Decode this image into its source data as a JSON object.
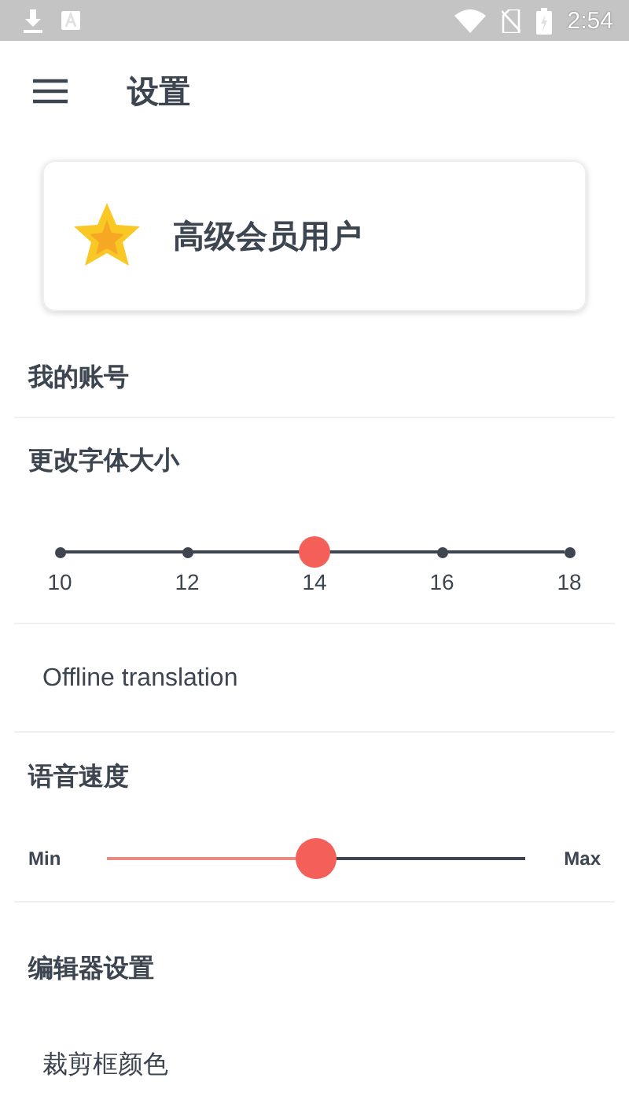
{
  "status_bar": {
    "time": "2:54"
  },
  "app_bar": {
    "title": "设置"
  },
  "premium_card": {
    "label": "高级会员用户"
  },
  "sections": [
    {
      "kind": "header",
      "label": "我的账号",
      "divider": true
    },
    {
      "kind": "steps",
      "label": "更改字体大小",
      "divider": true,
      "steps": [
        {
          "label": "10",
          "selected": false
        },
        {
          "label": "12",
          "selected": false
        },
        {
          "label": "14",
          "selected": true
        },
        {
          "label": "16",
          "selected": false
        },
        {
          "label": "18",
          "selected": false
        }
      ]
    },
    {
      "kind": "item",
      "label": "Offline translation",
      "divider": true
    },
    {
      "kind": "slider",
      "label": "语音速度",
      "divider": true,
      "min_label": "Min",
      "max_label": "Max",
      "level": 0.5
    },
    {
      "kind": "header",
      "label": "编辑器设置",
      "divider": false
    },
    {
      "kind": "item",
      "label": "裁剪框颜色",
      "divider": false
    }
  ]
}
